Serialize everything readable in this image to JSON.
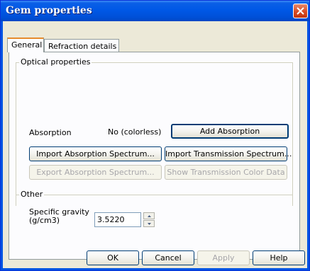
{
  "window": {
    "title": "Gem properties",
    "close_icon": "close-icon"
  },
  "tabs": [
    {
      "label": "General",
      "active": true
    },
    {
      "label": "Refraction details",
      "active": false
    }
  ],
  "optical": {
    "group_label": "Optical properties",
    "absorption_label": "Absorption",
    "absorption_value": "No (colorless)",
    "add_absorption": "Add Absorption",
    "import_absorption": "Import Absorption Spectrum...",
    "import_transmission": "Import Transmission Spectrum...",
    "export_absorption": "Export Absorption Spectrum...",
    "show_transmission": "Show Transmission Color Data"
  },
  "other": {
    "group_label": "Other",
    "sg_label_line1": "Specific gravity",
    "sg_label_line2": "(g/cm3)",
    "sg_value": "3.5220"
  },
  "footer": {
    "ok": "OK",
    "cancel": "Cancel",
    "apply": "Apply",
    "help": "Help"
  }
}
